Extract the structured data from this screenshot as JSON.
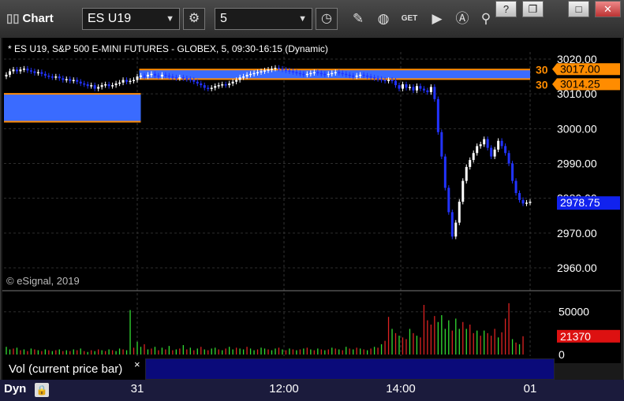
{
  "toolbar": {
    "title": "Chart",
    "symbol": "ES U19",
    "interval": "5",
    "get_label": "GET",
    "window_buttons": [
      "?",
      "❐",
      "□",
      "✕"
    ]
  },
  "chart_header": "* ES U19, S&P 500 E-MINI FUTURES - GLOBEX, 5, 09:30-16:15 (Dynamic)",
  "watermark": "© eSignal, 2019",
  "vol_legend": "Vol (current price bar)",
  "vol_close": "×",
  "bottom": {
    "dyn_label": "Dyn"
  },
  "chart_data": [
    {
      "type": "candlestick",
      "title": "* ES U19, S&P 500 E-MINI FUTURES - GLOBEX, 5, 09:30-16:15 (Dynamic)",
      "y_ticks": [
        3020,
        3010,
        3000,
        2990,
        2980,
        2970,
        2960
      ],
      "y_tick_labels": [
        "3020.00",
        "3010.00",
        "3000.00",
        "2990.00",
        "2980.00",
        "2970.00",
        "2960.00"
      ],
      "x_tick_labels": [
        "31",
        "12:00",
        "14:00",
        "01"
      ],
      "ylim": [
        2955,
        3022
      ],
      "grid": true,
      "last_price": "2978.75",
      "price_markers": [
        {
          "label": "3017.00",
          "prefix": "30",
          "value": 3017.0,
          "color": "#ff8c00"
        },
        {
          "label": "3014.25",
          "prefix": "30",
          "value": 3014.25,
          "color": "#ff8c00"
        }
      ],
      "zones": [
        {
          "from_bar": 0,
          "to_bar": 38,
          "low": 3002,
          "high": 3010,
          "color": "#3a6bff",
          "border": "#ff8c00"
        },
        {
          "from_bar": 38,
          "to_bar": 148,
          "low": 3014.25,
          "high": 3017,
          "color": "#3a6bff",
          "border": "#ff8c00"
        }
      ],
      "candles_close": [
        3015.5,
        3016.5,
        3017,
        3016.5,
        3017,
        3017.25,
        3016.75,
        3016.5,
        3016,
        3016.25,
        3015.75,
        3015.25,
        3015,
        3014.75,
        3015,
        3014.5,
        3014,
        3014.25,
        3013.75,
        3014,
        3013.5,
        3013,
        3012.75,
        3012.25,
        3012.5,
        3011.5,
        3012,
        3012.5,
        3012.75,
        3012.25,
        3012.5,
        3013,
        3013.25,
        3014,
        3013.5,
        3013.75,
        3014,
        3015,
        3015.25,
        3015,
        3015.5,
        3015.75,
        3015.25,
        3015,
        3015.5,
        3015.25,
        3015,
        3014.75,
        3014.5,
        3014.75,
        3014.5,
        3014.25,
        3014,
        3013.5,
        3013,
        3012.5,
        3011.75,
        3011.5,
        3011.75,
        3012.25,
        3012.5,
        3012.75,
        3012.5,
        3013,
        3013.5,
        3014,
        3014.75,
        3015,
        3015.5,
        3015.75,
        3016,
        3016.25,
        3016.5,
        3016.75,
        3017,
        3017.25,
        3017.5,
        3017.25,
        3017,
        3016.75,
        3016.5,
        3016.25,
        3016,
        3015.75,
        3015.5,
        3015.75,
        3016,
        3016.25,
        3016,
        3015.75,
        3015.5,
        3015.75,
        3016,
        3016.25,
        3016,
        3015.75,
        3015.5,
        3015.25,
        3015,
        3015.25,
        3015.5,
        3015.25,
        3015,
        3014.75,
        3014.5,
        3014.25,
        3014,
        3013.75,
        3014,
        3013.75,
        3012.5,
        3011.5,
        3012.75,
        3011.75,
        3012,
        3011,
        3012.25,
        3011.5,
        3011,
        3010.5,
        3012,
        3008.5,
        2999,
        2992,
        2983,
        2976,
        2969,
        2973,
        2979,
        2985,
        2989,
        2991,
        2993,
        2995,
        2995.5,
        2997,
        2994.5,
        2992,
        2994,
        2996.5,
        2995,
        2993,
        2990,
        2985,
        2981.5,
        2979.5,
        2978.5,
        2978.75,
        2979
      ],
      "volume_ticks": [
        50000,
        0
      ],
      "volume_tick_labels": [
        "50000",
        "0"
      ],
      "volume_last": "21370",
      "volume_values": [
        9000,
        6000,
        7000,
        8000,
        5000,
        6000,
        4000,
        7000,
        6000,
        5000,
        4000,
        6000,
        5000,
        4000,
        5000,
        6000,
        4000,
        5000,
        4000,
        6000,
        5000,
        7000,
        4000,
        3000,
        5000,
        4000,
        6000,
        5000,
        4000,
        6000,
        5000,
        4000,
        7000,
        6000,
        5000,
        52000,
        8000,
        15000,
        9000,
        12000,
        6000,
        7000,
        9000,
        5000,
        8000,
        6000,
        10000,
        5000,
        6000,
        7000,
        11000,
        6000,
        8000,
        5000,
        7000,
        9000,
        6000,
        5000,
        7000,
        8000,
        6000,
        5000,
        7000,
        9000,
        6000,
        8000,
        7000,
        6000,
        9000,
        7000,
        5000,
        6000,
        8000,
        7000,
        6000,
        5000,
        7000,
        8000,
        6000,
        5000,
        7000,
        6000,
        5000,
        6000,
        7000,
        8000,
        6000,
        5000,
        7000,
        6000,
        5000,
        6000,
        8000,
        7000,
        6000,
        5000,
        9000,
        7000,
        6000,
        8000,
        7000,
        6000,
        5000,
        7000,
        9000,
        8000,
        12000,
        16000,
        44000,
        30000,
        25000,
        22000,
        20000,
        18000,
        30000,
        25000,
        22000,
        20000,
        58000,
        40000,
        35000,
        45000,
        38000,
        46000,
        30000,
        40000,
        28000,
        42000,
        30000,
        38000,
        30000,
        35000,
        25000,
        28000,
        22000,
        28000,
        25000,
        22000,
        30000,
        20000,
        26000,
        42000,
        60000,
        18000,
        14000,
        12000,
        21370
      ],
      "volume_up": [
        true,
        true,
        false,
        true,
        false,
        true,
        false,
        true,
        false,
        true,
        false,
        true,
        false,
        true,
        false,
        true,
        false,
        true,
        false,
        true,
        false,
        true,
        false,
        true,
        false,
        true,
        false,
        true,
        false,
        true,
        false,
        true,
        true,
        false,
        true,
        true,
        false,
        true,
        true,
        false,
        true,
        false,
        true,
        false,
        true,
        false,
        true,
        false,
        true,
        false,
        true,
        false,
        true,
        false,
        true,
        false,
        true,
        false,
        true,
        true,
        false,
        true,
        false,
        true,
        true,
        false,
        true,
        true,
        false,
        true,
        true,
        false,
        true,
        true,
        false,
        true,
        true,
        false,
        true,
        false,
        true,
        false,
        true,
        false,
        true,
        false,
        true,
        false,
        true,
        false,
        true,
        false,
        true,
        false,
        true,
        false,
        true,
        false,
        true,
        false,
        true,
        false,
        true,
        false,
        true,
        false,
        true,
        false,
        false,
        true,
        false,
        true,
        false,
        false,
        true,
        false,
        true,
        false,
        false,
        false,
        false,
        false,
        true,
        true,
        true,
        true,
        false,
        true,
        true,
        false,
        true,
        false,
        false,
        true,
        false,
        true,
        false,
        false,
        false,
        true,
        false,
        false,
        false,
        true,
        false,
        true
      ]
    }
  ]
}
